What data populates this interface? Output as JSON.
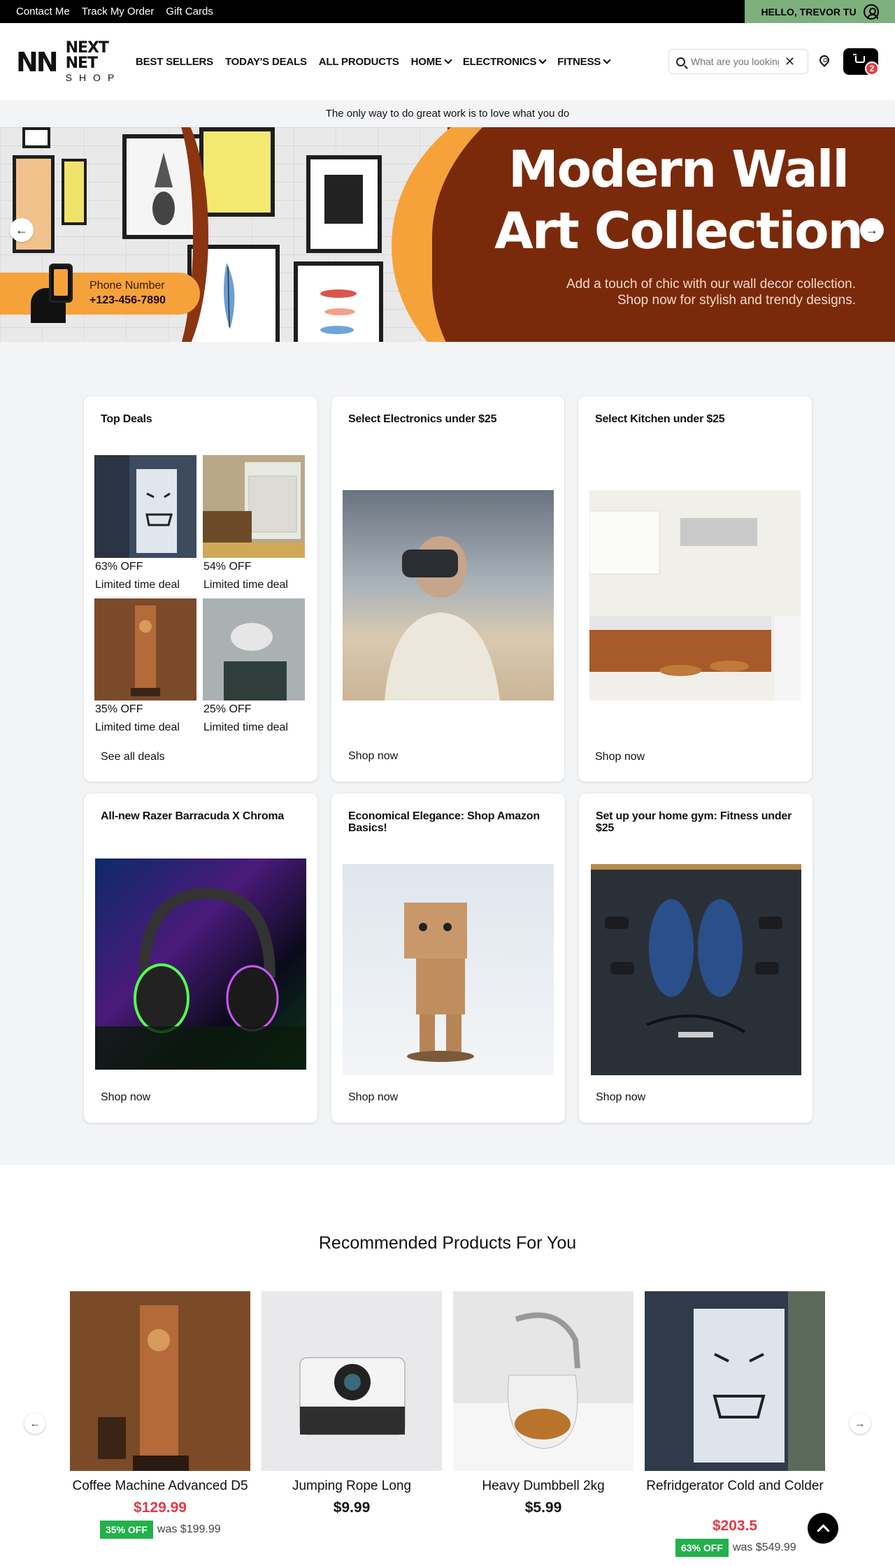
{
  "topbar": {
    "links": [
      "Contact Me",
      "Track My Order",
      "Gift Cards"
    ],
    "greeting": "HELLO, TREVOR TU"
  },
  "header": {
    "logo": {
      "mark": "NN",
      "line1": "NEXT NET",
      "line2": "SHOP"
    },
    "nav": [
      {
        "label": "BEST SELLERS",
        "dropdown": false
      },
      {
        "label": "TODAY'S DEALS",
        "dropdown": false
      },
      {
        "label": "ALL PRODUCTS",
        "dropdown": false
      },
      {
        "label": "HOME",
        "dropdown": true
      },
      {
        "label": "ELECTRONICS",
        "dropdown": true
      },
      {
        "label": "FITNESS",
        "dropdown": true
      }
    ],
    "search": {
      "placeholder": "What are you looking for?",
      "clear": "✕"
    },
    "cart_count": "2"
  },
  "quote": "The only way to do great work is to love what you do",
  "hero": {
    "headline_line1": "Modern Wall",
    "headline_line2": "Art Collection",
    "sub_line1": "Add a touch of chic with our wall decor collection.",
    "sub_line2": "Shop now for stylish and trendy designs.",
    "phone_label": "Phone Number",
    "phone_number": "+123-456-7890"
  },
  "cards": {
    "top_deals": {
      "title": "Top Deals",
      "deals": [
        {
          "off": "63% OFF",
          "note": "Limited time deal"
        },
        {
          "off": "54% OFF",
          "note": "Limited time deal"
        },
        {
          "off": "35% OFF",
          "note": "Limited time deal"
        },
        {
          "off": "25% OFF",
          "note": "Limited time deal"
        }
      ],
      "link": "See all deals"
    },
    "electronics": {
      "title": "Select Electronics under $25",
      "link": "Shop now"
    },
    "kitchen": {
      "title": "Select Kitchen under $25",
      "link": "Shop now"
    },
    "razer": {
      "title": "All-new Razer Barracuda X Chroma",
      "link": "Shop now"
    },
    "basics": {
      "title": "Economical Elegance: Shop Amazon Basics!",
      "link": "Shop now"
    },
    "gym": {
      "title": "Set up your home gym: Fitness under $25",
      "link": "Shop now"
    }
  },
  "recommended": {
    "title": "Recommended Products For You",
    "products": [
      {
        "name": "Coffee Machine Advanced D5",
        "price": "$129.99",
        "discount": "35% OFF",
        "was": "was $199.99"
      },
      {
        "name": "Jumping Rope Long",
        "price": "$9.99"
      },
      {
        "name": "Heavy Dumbbell 2kg",
        "price": "$5.99"
      },
      {
        "name": "Refridgerator Cold and Colder",
        "price": "$203.5",
        "discount": "63% OFF",
        "was": "was $549.99"
      }
    ]
  },
  "colors": {
    "accent_green": "#7db07d",
    "price_red": "#e53945",
    "discount_green": "#22b14c",
    "hero_brown": "#7a2a0a",
    "hero_orange": "#f6a23a"
  }
}
